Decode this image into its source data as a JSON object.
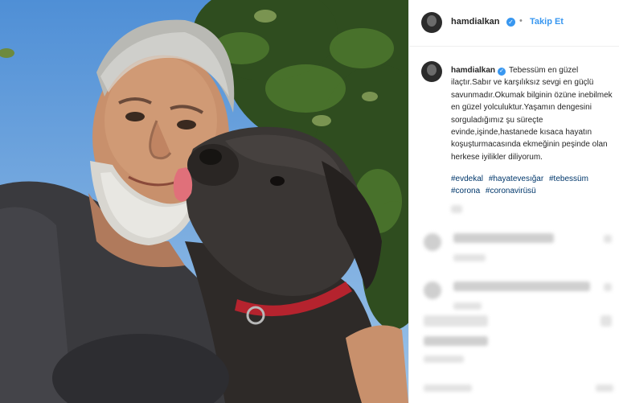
{
  "header": {
    "username": "hamdialkan",
    "verified_icon": "verified-badge-icon",
    "separator": "•",
    "follow_label": "Takip Et"
  },
  "caption": {
    "username": "hamdialkan",
    "text": "Tebessüm en güzel ilaçtır.Sabır ve karşılıksız sevgi en güçlü savunmadır.Okumak bilginin özüne inebilmek en güzel yolculuktur.Yaşamın dengesini sorguladığımız şu süreçte evinde,işinde,hastanede kısaca hayatın koşuşturmacasında ekmeğinin peşinde olan herkese iyilikler diliyorum.",
    "hashtags": [
      "#evdekal",
      "#hayatevesığar",
      "#tebessüm",
      "#corona",
      "#coronavirüsü"
    ]
  },
  "colors": {
    "accent": "#3897f0",
    "hashtag": "#00376b",
    "border": "#efefef",
    "blurred": "#e3e3e3"
  }
}
